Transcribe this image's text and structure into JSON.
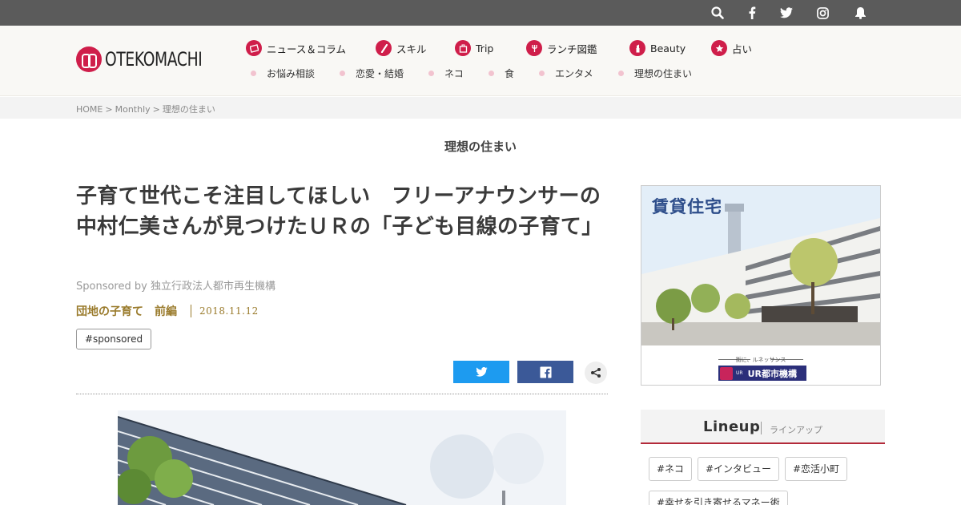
{
  "topbar": {
    "icons": [
      "search-icon",
      "facebook-icon",
      "twitter-icon",
      "instagram-icon",
      "bell-icon"
    ],
    "bg": "#5b5b5b"
  },
  "brand": {
    "name": "OTEKOMACHI",
    "color": "#cf1e4a"
  },
  "nav": {
    "main": [
      {
        "label": "ニュース＆コラム",
        "icon": "news-icon"
      },
      {
        "label": "スキル",
        "icon": "pencil-icon"
      },
      {
        "label": "Trip",
        "icon": "suitcase-icon"
      },
      {
        "label": "ランチ図鑑",
        "icon": "fork-icon"
      },
      {
        "label": "Beauty",
        "icon": "lipstick-icon"
      },
      {
        "label": "占い",
        "icon": "star-icon"
      }
    ],
    "sub": [
      "お悩み相談",
      "恋愛・結婚",
      "ネコ",
      "食",
      "エンタメ",
      "理想の住まい"
    ]
  },
  "breadcrumb": {
    "home": "HOME",
    "monthly": "Monthly",
    "current": "理想の住まい",
    "separator": ">"
  },
  "section_title": "理想の住まい",
  "article": {
    "title": "子育て世代こそ注目してほしい　フリーアナウンサーの中村仁美さんが見つけたＵＲの「子ども目線の子育て」",
    "sponsored": "Sponsored by 独立行政法人都市再生機構",
    "series": "団地の子育て　前編",
    "date": "2018.11.12",
    "tag": "#sponsored"
  },
  "share": {
    "twitter_color": "#1d9bf0",
    "facebook_color": "#3b5998"
  },
  "ad": {
    "title": "賃貸住宅",
    "tagline": "街に、ルネッサンス",
    "logo_small": "UR",
    "logo_name": "UR都市機構"
  },
  "lineup": {
    "title": "Lineup",
    "subtitle": "ラインアップ",
    "accent": "#b32a3a",
    "tags": [
      "#ネコ",
      "#インタビュー",
      "#恋活小町",
      "#幸せを引き寄せるマネー術"
    ]
  }
}
